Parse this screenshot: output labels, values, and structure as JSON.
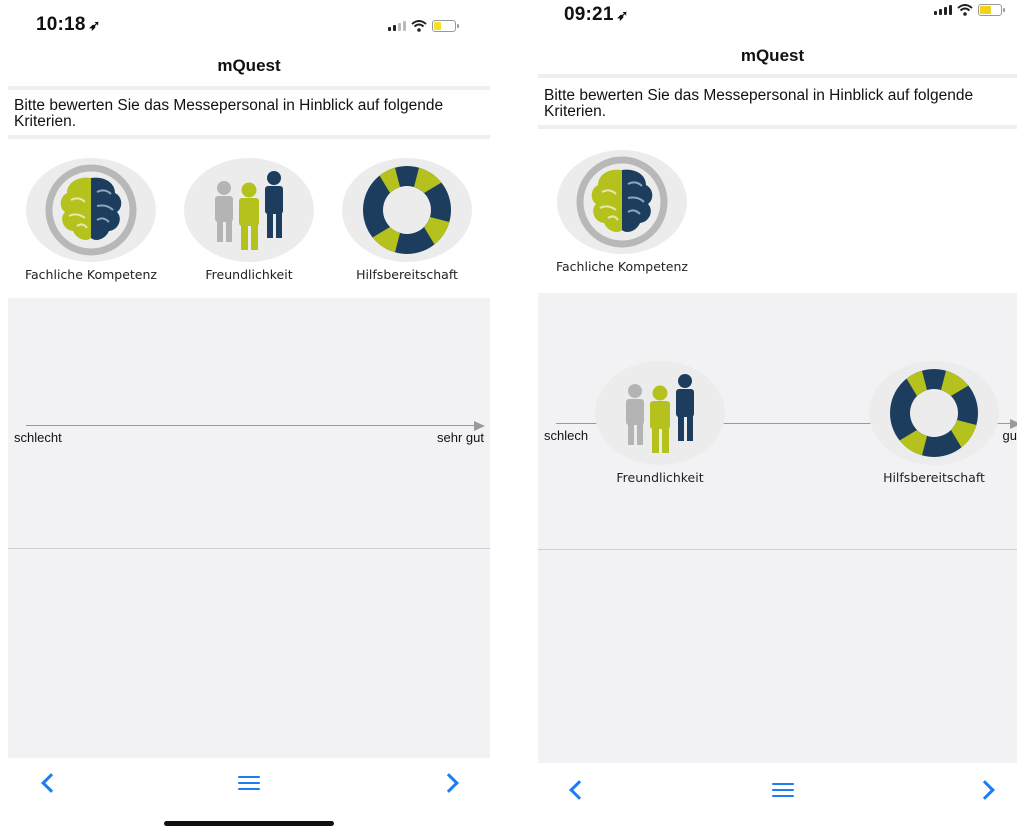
{
  "screens": [
    {
      "status": {
        "time": "10:18",
        "battery_color": "#f2e12a"
      },
      "app_title": "mQuest",
      "question": "Bitte bewerten Sie das Messepersonal in Hinblick auf folgende Kriterien.",
      "options": [
        {
          "label": "Fachliche Kompetenz",
          "icon": "brain-icon"
        },
        {
          "label": "Freundlichkeit",
          "icon": "people-icon"
        },
        {
          "label": "Hilfsbereitschaft",
          "icon": "lifebuoy-icon"
        }
      ],
      "scale": {
        "min_label": "schlecht",
        "max_label": "sehr gut"
      },
      "nav": {
        "back": "back-chevron-icon",
        "menu": "menu-icon",
        "next": "next-chevron-icon"
      }
    },
    {
      "status": {
        "time": "09:21",
        "battery_color": "#f2d21a"
      },
      "app_title": "mQuest",
      "question": "Bitte bewerten Sie das Messepersonal in Hinblick auf folgende Kriterien.",
      "options": [
        {
          "label": "Fachliche Kompetenz",
          "icon": "brain-icon"
        }
      ],
      "placed": [
        {
          "label": "Freundlichkeit",
          "icon": "people-icon"
        },
        {
          "label": "Hilfsbereitschaft",
          "icon": "lifebuoy-icon"
        }
      ],
      "scale": {
        "min_label": "schlech",
        "max_label": "gu"
      },
      "nav": {
        "back": "back-chevron-icon",
        "menu": "menu-icon",
        "next": "next-chevron-icon"
      }
    }
  ],
  "colors": {
    "accent": "#1e7cf2",
    "green": "#b5c21e",
    "navy": "#1c3d5e",
    "grey_icon": "#b4b4b4"
  }
}
